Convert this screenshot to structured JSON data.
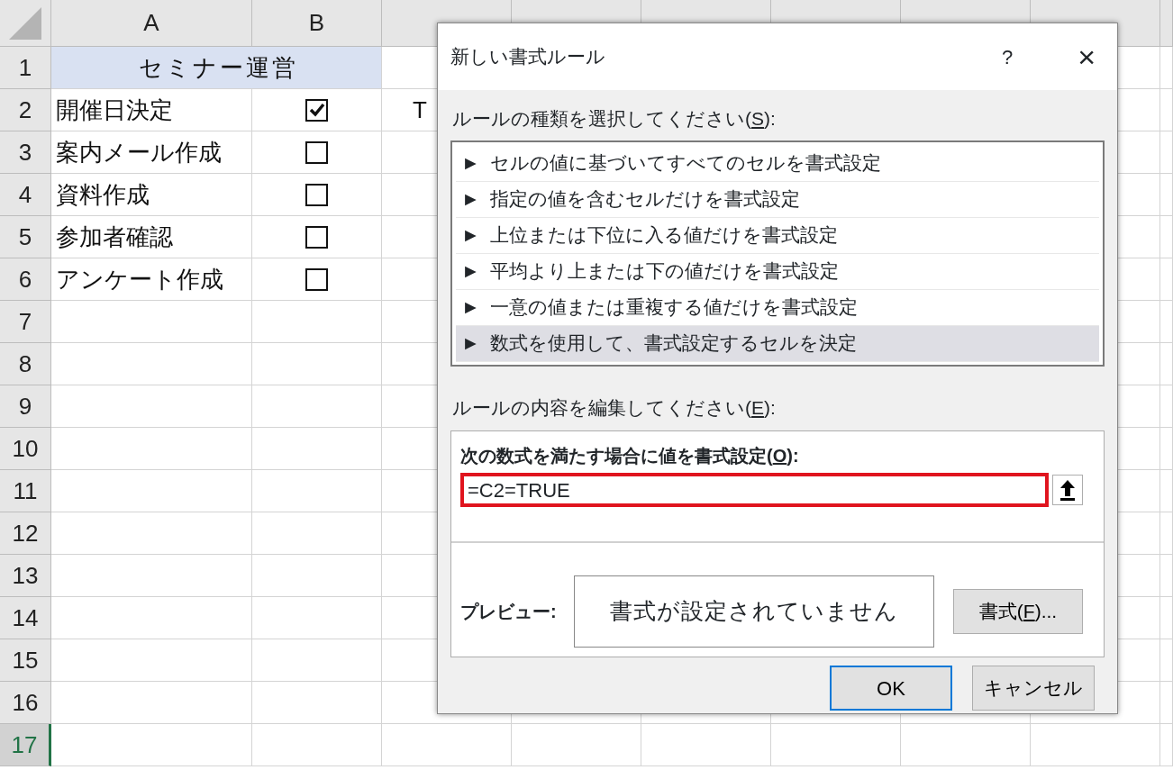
{
  "sheet": {
    "columns": [
      "A",
      "B"
    ],
    "rows": [
      {
        "number": "1",
        "selected": false,
        "title": "セミナー運営"
      },
      {
        "number": "2",
        "selected": false,
        "task": "開催日決定",
        "checked": true,
        "column_c": "T"
      },
      {
        "number": "3",
        "selected": false,
        "task": "案内メール作成",
        "checked": false
      },
      {
        "number": "4",
        "selected": false,
        "task": "資料作成",
        "checked": false
      },
      {
        "number": "5",
        "selected": false,
        "task": "参加者確認",
        "checked": false
      },
      {
        "number": "6",
        "selected": false,
        "task": "アンケート作成",
        "checked": false
      },
      {
        "number": "7",
        "selected": false
      },
      {
        "number": "8",
        "selected": false
      },
      {
        "number": "9",
        "selected": false
      },
      {
        "number": "10",
        "selected": false
      },
      {
        "number": "11",
        "selected": false
      },
      {
        "number": "12",
        "selected": false
      },
      {
        "number": "13",
        "selected": false
      },
      {
        "number": "14",
        "selected": false
      },
      {
        "number": "15",
        "selected": false
      },
      {
        "number": "16",
        "selected": false
      },
      {
        "number": "17",
        "selected": true
      }
    ]
  },
  "dialog": {
    "title": "新しい書式ルール",
    "help": "?",
    "close": "×",
    "rule_type_label": {
      "before": "ルールの種類を選択してください(",
      "key": "S",
      "after": "):"
    },
    "rule_types": [
      {
        "marker": "►",
        "label": "セルの値に基づいてすべてのセルを書式設定",
        "selected": false
      },
      {
        "marker": "►",
        "label": "指定の値を含むセルだけを書式設定",
        "selected": false
      },
      {
        "marker": "►",
        "label": "上位または下位に入る値だけを書式設定",
        "selected": false
      },
      {
        "marker": "►",
        "label": "平均より上または下の値だけを書式設定",
        "selected": false
      },
      {
        "marker": "►",
        "label": "一意の値または重複する値だけを書式設定",
        "selected": false
      },
      {
        "marker": "►",
        "label": "数式を使用して、書式設定するセルを決定",
        "selected": true
      }
    ],
    "edit_label": {
      "before": "ルールの内容を編集してください(",
      "key": "E",
      "after": "):"
    },
    "formula_label": {
      "before": "次の数式を満たす場合に値を書式設定(",
      "key": "O",
      "after": "):"
    },
    "formula": "=C2=TRUE",
    "preview_label": "プレビュー:",
    "preview_text": "書式が設定されていません",
    "format_button": {
      "before": "書式(",
      "key": "F",
      "after": ")..."
    },
    "ok": "OK",
    "cancel": "キャンセル"
  }
}
